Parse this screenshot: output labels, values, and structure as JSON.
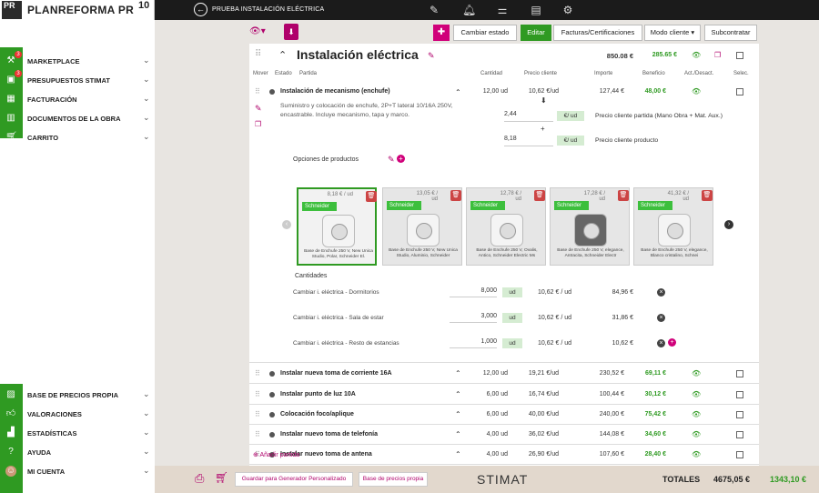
{
  "app": {
    "logo_pr": "PR",
    "logo_name": "PLANREFORMA PR",
    "logo_ten": "10",
    "project": "PRUEBA INSTALACIÓN ELÉCTRICA"
  },
  "sidebar": {
    "items": [
      {
        "label": "MARKETPLACE",
        "badge": "3"
      },
      {
        "label": "PRESUPUESTOS STIMAT",
        "badge": "3"
      },
      {
        "label": "FACTURACIÓN"
      },
      {
        "label": "DOCUMENTOS DE LA OBRA"
      },
      {
        "label": "CARRITO"
      },
      {
        "label": "BASE DE PRECIOS PROPIA"
      },
      {
        "label": "VALORACIONES"
      },
      {
        "label": "ESTADÍSTICAS"
      },
      {
        "label": "AYUDA"
      },
      {
        "label": "MI CUENTA"
      }
    ]
  },
  "toolbar": {
    "cambiar_estado": "Cambiar estado",
    "editar": "Editar",
    "facturas": "Facturas/Certificaciones",
    "modo": "Modo cliente",
    "subcontratar": "Subcontratar"
  },
  "section": {
    "title": "Instalación eléctrica",
    "total": "850.08 €",
    "benefit": "285.65 €"
  },
  "headers": {
    "mover": "Mover",
    "estado": "Estado",
    "partida": "Partida",
    "cantidad": "Cantidad",
    "precio": "Precio cliente",
    "importe": "Importe",
    "beneficio": "Beneficio",
    "act": "Act./Desact.",
    "selec": "Selec."
  },
  "main_row": {
    "name": "Instalación de mecanismo (enchufe)",
    "qty": "12,00 ud",
    "price": "10,62 €/ud",
    "amount": "127,44 €",
    "benefit": "48,00 €",
    "desc": "Suministro y colocación de enchufe, 2P+T lateral 10/16A 250V, encastrable. Incluye mecanismo, tapa y marco.",
    "factor": "2,44",
    "factor_unit": "€/ ud",
    "factor_label": "Precio cliente partida (Mano Obra + Mat. Aux.)",
    "prod_price": "8,18",
    "prod_unit": "€/ ud",
    "prod_label": "Precio cliente producto",
    "minus": "+",
    "plus": "+"
  },
  "options": {
    "title": "Opciones de productos",
    "products": [
      {
        "price": "8,18 € / ud",
        "brand": "Schneider",
        "desc": "Base de Enchufe 250 V, New Unica Studio, Polar, Schneider El."
      },
      {
        "price": "13,05 € / ud",
        "brand": "Schneider",
        "desc": "Base de Enchufe 250 V, New Unica Studio, Aluminio, Schneider"
      },
      {
        "price": "12,78 € / ud",
        "brand": "Schneider",
        "desc": "Base de Enchufe 250 V, Ovalis, Antico, Schneider Electric Ms"
      },
      {
        "price": "17,28 € / ud",
        "brand": "Schneider",
        "desc": "Base de Enchufe 250 V, elegance, Antracita, Schneider Electr"
      },
      {
        "price": "41,32 € / ud",
        "brand": "Schneider",
        "desc": "Base de Enchufe 250 V, elegance, Blanco cristalino, Schnei"
      }
    ]
  },
  "cantidades": {
    "title": "Cantidades",
    "rows": [
      {
        "label": "Cambiar i. eléctrica - Dormitorios",
        "qty": "8,000",
        "unit": "ud",
        "price": "10,62 € / ud",
        "amount": "84,96 €"
      },
      {
        "label": "Cambiar i. eléctrica - Sala de estar",
        "qty": "3,000",
        "unit": "ud",
        "price": "10,62 € / ud",
        "amount": "31,86 €"
      },
      {
        "label": "Cambiar i. eléctrica - Resto de estancias",
        "qty": "1,000",
        "unit": "ud",
        "price": "10,62 € / ud",
        "amount": "10,62 €"
      }
    ]
  },
  "rows": [
    {
      "name": "Instalar nueva toma de corriente 16A",
      "qty": "12,00 ud",
      "price": "19,21 €/ud",
      "amount": "230,52 €",
      "benefit": "69,11 €"
    },
    {
      "name": "Instalar punto de luz 10A",
      "qty": "6,00 ud",
      "price": "16,74 €/ud",
      "amount": "100,44 €",
      "benefit": "30,12 €"
    },
    {
      "name": "Colocación foco/aplique",
      "qty": "6,00 ud",
      "price": "40,00 €/ud",
      "amount": "240,00 €",
      "benefit": "75,42 €"
    },
    {
      "name": "Instalar nuevo toma de telefonía",
      "qty": "4,00 ud",
      "price": "36,02 €/ud",
      "amount": "144,08 €",
      "benefit": "34,60 €"
    },
    {
      "name": "Instalar nuevo toma de antena",
      "qty": "4,00 ud",
      "price": "26,90 €/ud",
      "amount": "107,60 €",
      "benefit": "28,40 €"
    }
  ],
  "add_partida": "Añadir partida",
  "bottom": {
    "guardar": "Guardar para Generador Personalizado",
    "base": "Base de precios propia",
    "brand": "STIMAT",
    "totales": "TOTALES",
    "total": "4675,05 €",
    "benefit": "1343,10 €"
  }
}
